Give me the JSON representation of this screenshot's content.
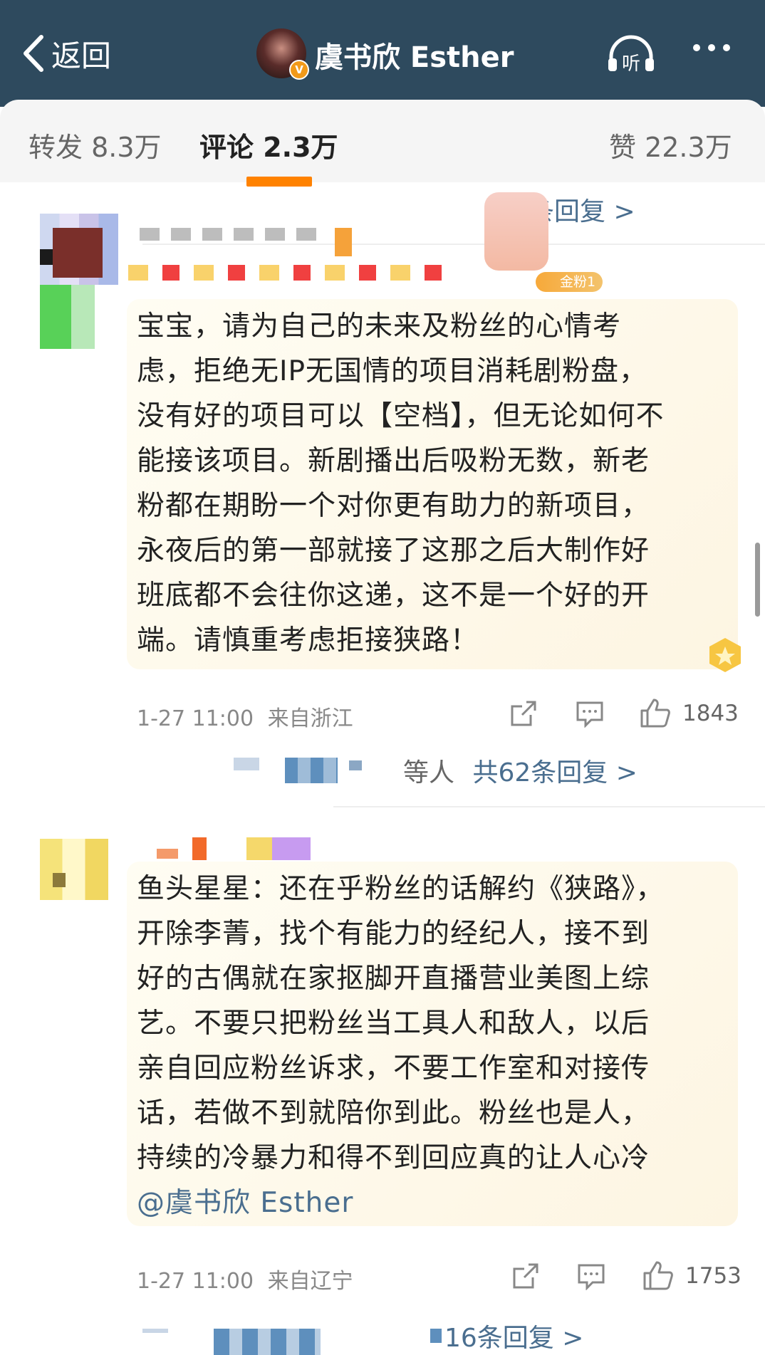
{
  "header": {
    "back_label": "返回",
    "title": "虞书欣 Esther",
    "verified_mark": "V",
    "listen_label": "听"
  },
  "tabs": {
    "repost": "转发 8.3万",
    "comments": "评论 2.3万",
    "likes": "赞 22.3万"
  },
  "reply_links": {
    "top_partial": "条回复 >",
    "first": {
      "prefix": "等人",
      "label": "共62条回复 >"
    },
    "second": {
      "label": "16条回复 >"
    }
  },
  "comments": [
    {
      "fan_badge": "金粉1",
      "lines": [
        "宝宝，请为自己的未来及粉丝的心情考",
        "虑，拒绝无IP无国情的项目消耗剧粉盘，",
        "没有好的项目可以【空档】，但无论如何不",
        "能接该项目。新剧播出后吸粉无数，新老",
        "粉都在期盼一个对你更有助力的新项目，",
        "永夜后的第一部就接了这那之后大制作好",
        "班底都不会往你这递，这不是一个好的开",
        "端。请慎重考虑拒接狭路！"
      ],
      "time": "1-27 11:00",
      "location": "来自浙江",
      "like_count": "1843"
    },
    {
      "lines": [
        "鱼头星星：还在乎粉丝的话解约《狭路》，",
        "开除李菁，找个有能力的经纪人，接不到",
        "好的古偶就在家抠脚开直播营业美图上综",
        "艺。不要只把粉丝当工具人和敌人，以后",
        "亲自回应粉丝诉求，不要工作室和对接传",
        "话，若做不到就陪你到此。粉丝也是人，",
        "持续的冷暴力和得不到回应真的让人心冷"
      ],
      "mention": "@虞书欣 Esther",
      "time": "1-27 11:00",
      "location": "来自辽宁",
      "like_count": "1753"
    }
  ],
  "colors": {
    "header_bg": "#2e4a5e",
    "accent_orange": "#ff8200",
    "link_blue": "#4a6e8f"
  },
  "icons": [
    "chevron-left-icon",
    "headphones-icon",
    "more-icon",
    "share-icon",
    "comment-icon",
    "thumbs-up-icon",
    "star-badge-icon"
  ]
}
